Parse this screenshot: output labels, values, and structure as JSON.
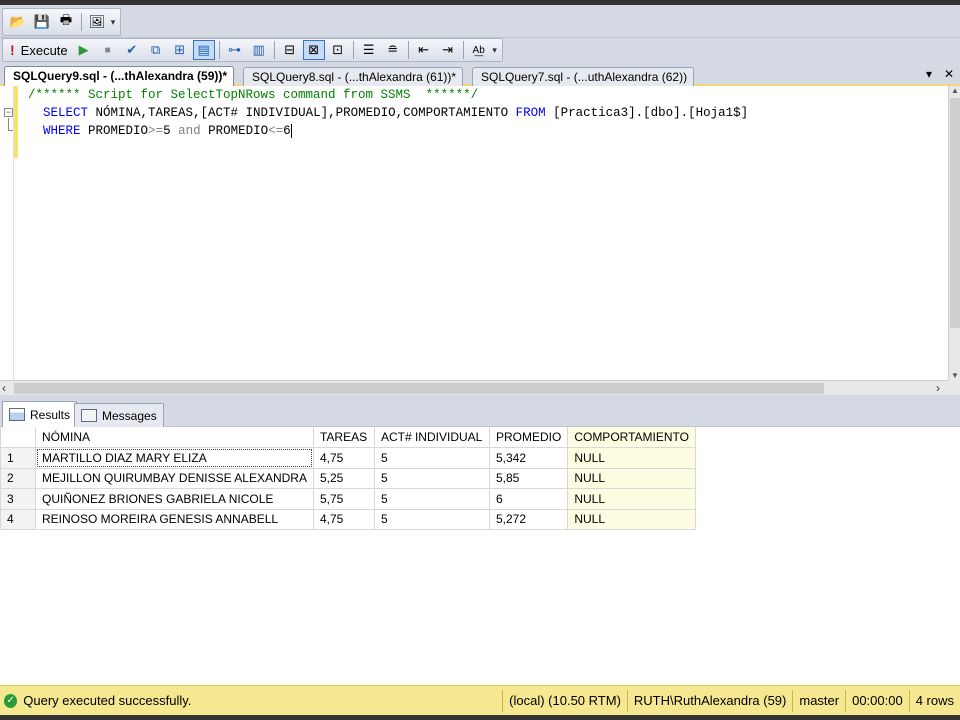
{
  "toolbar": {
    "execute_label": "Execute"
  },
  "tabs": [
    {
      "label": "SQLQuery9.sql - (...thAlexandra (59))*",
      "active": true
    },
    {
      "label": "SQLQuery8.sql - (...thAlexandra (61))*",
      "active": false
    },
    {
      "label": "SQLQuery7.sql - (...uthAlexandra (62))",
      "active": false
    }
  ],
  "editor": {
    "comment": "/****** Script for SelectTopNRows command from SSMS  ******/",
    "line2": {
      "kw_select": "SELECT",
      "columns": " NÓMINA,TAREAS,[ACT# INDIVIDUAL],PROMEDIO,COMPORTAMIENTO ",
      "kw_from": "FROM",
      "table": " [Practica3].[dbo].[Hoja1$]"
    },
    "line3": {
      "kw_where": "WHERE",
      "col1": " PROMEDIO",
      "op1": ">=",
      "val1": "5 ",
      "kw_and": "and",
      "col2": " PROMEDIO",
      "op2": "<=",
      "val2": "6"
    }
  },
  "result_tabs": {
    "results": "Results",
    "messages": "Messages"
  },
  "grid": {
    "columns": [
      "NÓMINA",
      "TAREAS",
      "ACT# INDIVIDUAL",
      "PROMEDIO",
      "COMPORTAMIENTO"
    ],
    "rows": [
      {
        "n": "1",
        "nomina": "MARTILLO DIAZ MARY ELIZA",
        "tareas": "4,75",
        "act": "5",
        "promedio": "5,342",
        "comp": "NULL"
      },
      {
        "n": "2",
        "nomina": "MEJILLON QUIRUMBAY DENISSE ALEXANDRA",
        "tareas": "5,25",
        "act": "5",
        "promedio": "5,85",
        "comp": "NULL"
      },
      {
        "n": "3",
        "nomina": "QUIÑONEZ BRIONES GABRIELA NICOLE",
        "tareas": "5,75",
        "act": "5",
        "promedio": "6",
        "comp": "NULL"
      },
      {
        "n": "4",
        "nomina": "REINOSO MOREIRA GENESIS ANNABELL",
        "tareas": "4,75",
        "act": "5",
        "promedio": "5,272",
        "comp": "NULL"
      }
    ]
  },
  "status": {
    "message": "Query executed successfully.",
    "server": "(local) (10.50 RTM)",
    "user": "RUTH\\RuthAlexandra (59)",
    "database": "master",
    "time": "00:00:00",
    "rows": "4 rows"
  }
}
